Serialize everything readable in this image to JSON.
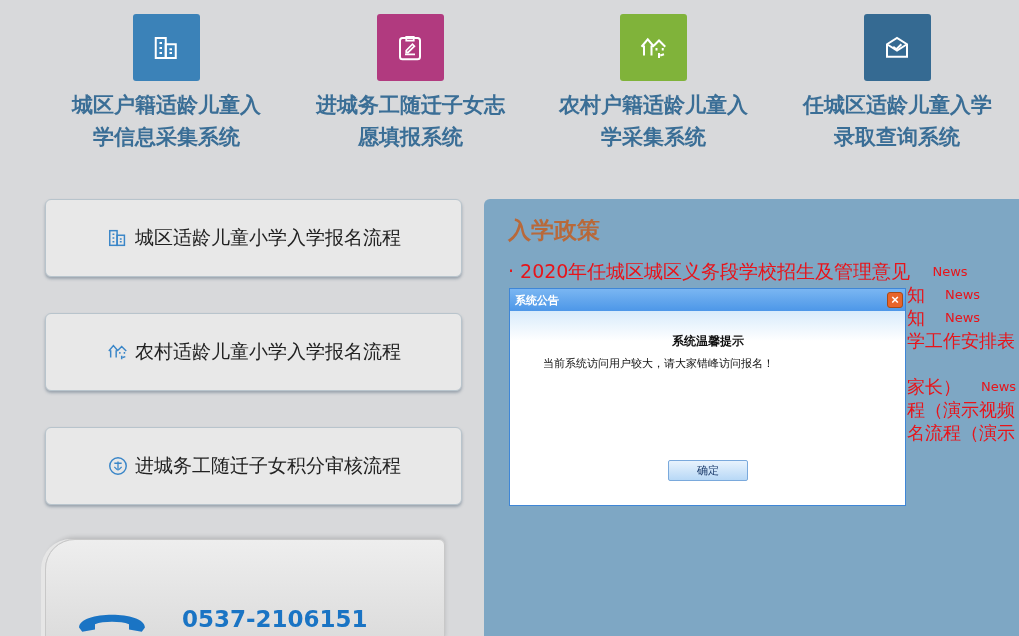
{
  "systems": [
    {
      "kind": "building",
      "color": "#3b82b8",
      "title": [
        "城区户籍适龄儿童入",
        "学信息采集系统"
      ]
    },
    {
      "kind": "form",
      "color": "#b13a7f",
      "title": [
        "进城务工随迁子女志",
        "愿填报系统"
      ]
    },
    {
      "kind": "village",
      "color": "#80b33a",
      "title": [
        "农村户籍适龄儿童入",
        "学采集系统"
      ]
    },
    {
      "kind": "mail",
      "color": "#356a92",
      "title": [
        "任城区适龄儿童入学",
        "录取查询系统"
      ]
    }
  ],
  "process_buttons": [
    {
      "kind": "building",
      "label": "城区适龄儿童小学入学报名流程"
    },
    {
      "kind": "village",
      "label": "农村适龄儿童小学入学报名流程"
    },
    {
      "kind": "points",
      "label": "进城务工随迁子女积分审核流程"
    }
  ],
  "contact": {
    "phone": "0537-2106151"
  },
  "policy": {
    "title": "入学政策",
    "items": [
      {
        "kind": "full",
        "text": "· 2020年任城区城区义务段学校招生及管理意见",
        "tag": "News"
      },
      {
        "kind": "fragment",
        "text": "知",
        "tag": "News"
      },
      {
        "kind": "fragment",
        "text": "知",
        "tag": "News"
      },
      {
        "kind": "fragment",
        "text": "学工作安排表"
      },
      {
        "kind": "fragment",
        "text": "家长）",
        "tag": "News"
      },
      {
        "kind": "fragment",
        "text": "程（演示视频"
      },
      {
        "kind": "fragment",
        "text": "名流程（演示"
      }
    ]
  },
  "dialog": {
    "title": "系统公告",
    "close": "×",
    "heading": "系统温馨提示",
    "message": "当前系统访问用户较大，请大家错峰访问报名！",
    "button": "确定"
  }
}
